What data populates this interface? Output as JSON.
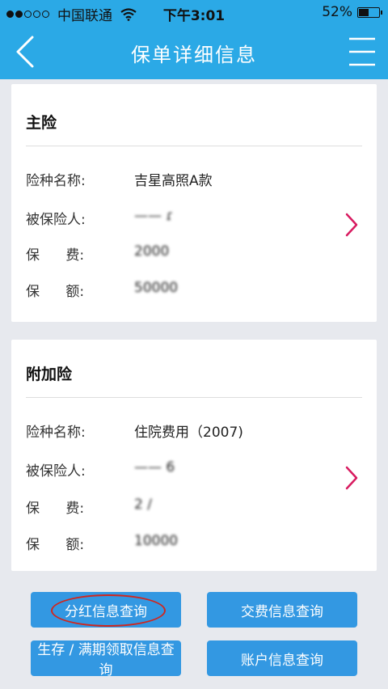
{
  "status_bar": {
    "carrier": "中国联通",
    "time": "下午3:01",
    "battery": "52%",
    "battery_level": 0.52,
    "signal_filled": 2,
    "signal_total": 5
  },
  "nav": {
    "title": "保单详细信息",
    "back_icon": "chevron-left-icon",
    "menu_icon": "hamburger-menu-icon"
  },
  "main_insurance": {
    "title": "主险",
    "fields": [
      {
        "label": "险种名称:",
        "value": "吉星高照A款"
      },
      {
        "label": "被保险人:",
        "value": "—— ɾ"
      },
      {
        "label": "保      费:",
        "value": "2000"
      },
      {
        "label": "保      额:",
        "value": "50000"
      }
    ]
  },
  "rider_insurance": {
    "title": "附加险",
    "fields": [
      {
        "label": "险种名称:",
        "value": "住院费用（2007)"
      },
      {
        "label": "被保险人:",
        "value": "—— 6"
      },
      {
        "label": "保      费:",
        "value": "2 /"
      },
      {
        "label": "保      额:",
        "value": "10000"
      }
    ]
  },
  "buttons": {
    "dividend": "分红信息查询",
    "payment": "交费信息查询",
    "survival": "生存 / 满期领取信息查询",
    "account": "账户信息查询"
  },
  "colors": {
    "header": "#2ba9e6",
    "button": "#3398e2",
    "chevron": "#d81b60",
    "highlight_ring": "#d0261d",
    "background": "#e7e9ee"
  }
}
